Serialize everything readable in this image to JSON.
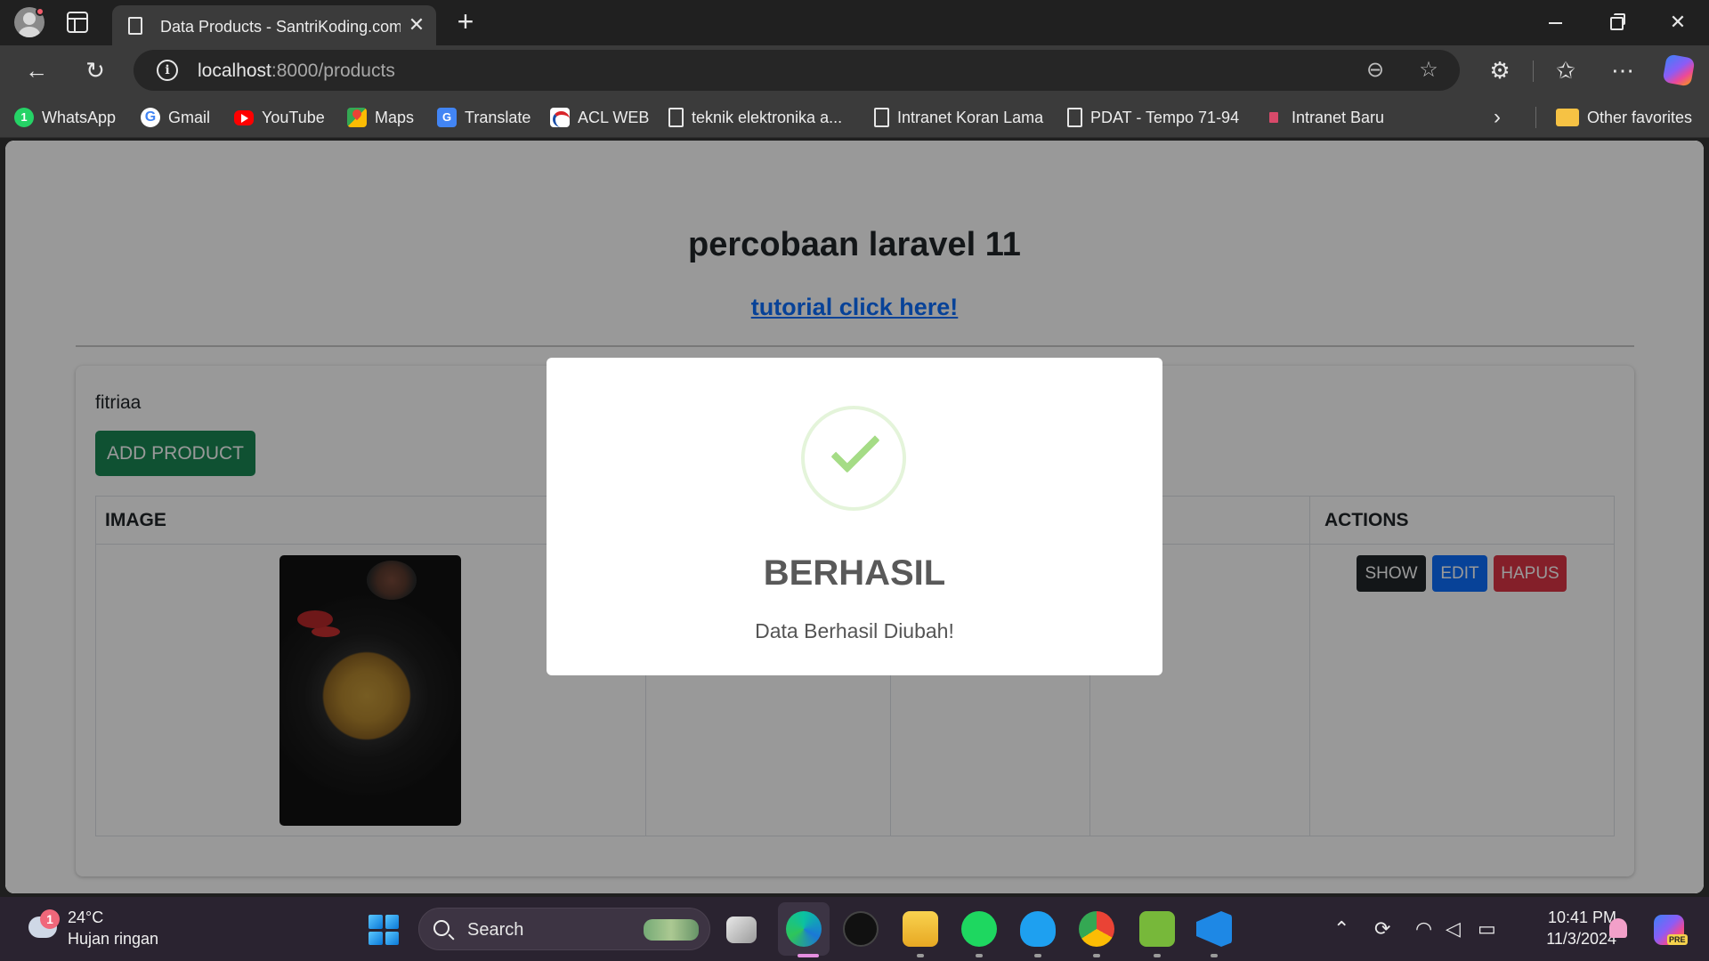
{
  "browser": {
    "tab_title": "Data Products - SantriKoding.com",
    "url_host": "localhost",
    "url_rest": ":8000/products",
    "bookmarks": [
      {
        "label": "WhatsApp",
        "icon": "whatsapp-icon"
      },
      {
        "label": "Gmail",
        "icon": "google-icon"
      },
      {
        "label": "YouTube",
        "icon": "youtube-icon"
      },
      {
        "label": "Maps",
        "icon": "maps-icon"
      },
      {
        "label": "Translate",
        "icon": "translate-icon"
      },
      {
        "label": "ACL WEB",
        "icon": "acl-icon"
      },
      {
        "label": "teknik elektronika a...",
        "icon": "page-icon"
      },
      {
        "label": "Intranet Koran Lama",
        "icon": "page-icon"
      },
      {
        "label": "PDAT - Tempo 71-94",
        "icon": "page-icon"
      },
      {
        "label": "Intranet Baru",
        "icon": "intranet-icon"
      }
    ],
    "other_favorites": "Other favorites"
  },
  "page": {
    "title": "percobaan laravel 11",
    "link": "tutorial click here!",
    "user": "fitriaa",
    "add_button": "ADD PRODUCT",
    "table": {
      "col_image": "IMAGE",
      "col_actions": "ACTIONS"
    },
    "actions": {
      "show": "SHOW",
      "edit": "EDIT",
      "delete": "HAPUS"
    }
  },
  "modal": {
    "title": "BERHASIL",
    "message": "Data Berhasil Diubah!"
  },
  "taskbar": {
    "weather_temp": "24°C",
    "weather_desc": "Hujan ringan",
    "weather_badge": "1",
    "search": "Search",
    "time": "10:41 PM",
    "date": "11/3/2024",
    "copilot_badge": "PRE"
  },
  "colors": {
    "add_button": "#198754",
    "show_button": "#212529",
    "edit_button": "#0d6efd",
    "delete_button": "#dc3545",
    "success_check": "#a5dc86"
  }
}
